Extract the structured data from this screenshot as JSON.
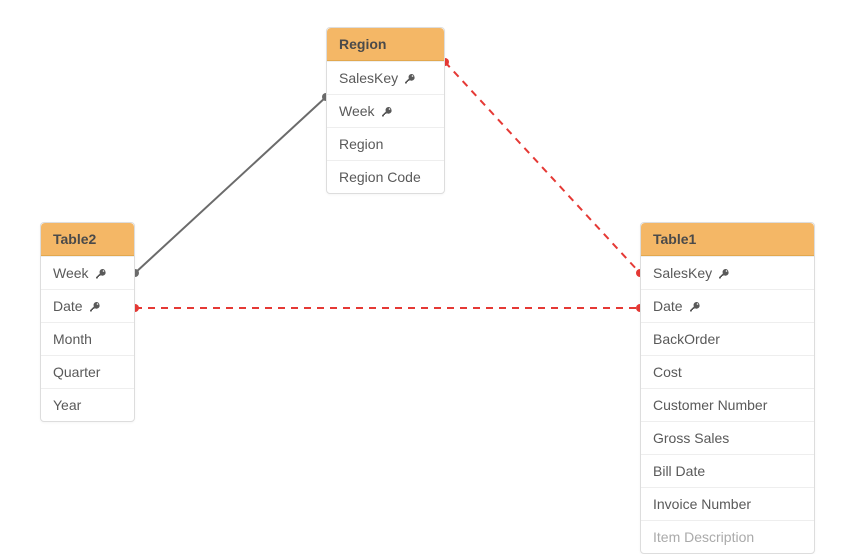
{
  "tables": {
    "region": {
      "title": "Region",
      "fields": [
        {
          "name": "SalesKey",
          "isKey": true
        },
        {
          "name": "Week",
          "isKey": true
        },
        {
          "name": "Region",
          "isKey": false
        },
        {
          "name": "Region Code",
          "isKey": false
        }
      ]
    },
    "table2": {
      "title": "Table2",
      "fields": [
        {
          "name": "Week",
          "isKey": true
        },
        {
          "name": "Date",
          "isKey": true
        },
        {
          "name": "Month",
          "isKey": false
        },
        {
          "name": "Quarter",
          "isKey": false
        },
        {
          "name": "Year",
          "isKey": false
        }
      ]
    },
    "table1": {
      "title": "Table1",
      "fields": [
        {
          "name": "SalesKey",
          "isKey": true
        },
        {
          "name": "Date",
          "isKey": true
        },
        {
          "name": "BackOrder",
          "isKey": false
        },
        {
          "name": "Cost",
          "isKey": false
        },
        {
          "name": "Customer Number",
          "isKey": false
        },
        {
          "name": "Gross Sales",
          "isKey": false
        },
        {
          "name": "Bill Date",
          "isKey": false
        },
        {
          "name": "Invoice Number",
          "isKey": false
        },
        {
          "name": "Item Description",
          "isKey": false
        }
      ]
    }
  },
  "relationships": [
    {
      "from": "table2.Week",
      "to": "region.Week",
      "type": "solid"
    },
    {
      "from": "region.SalesKey",
      "to": "table1.SalesKey",
      "type": "dashed"
    },
    {
      "from": "table2.Date",
      "to": "table1.Date",
      "type": "dashed"
    }
  ],
  "colors": {
    "headerBg": "#f4b766",
    "solidLine": "#6b6b6b",
    "dashedLine": "#e53935"
  }
}
